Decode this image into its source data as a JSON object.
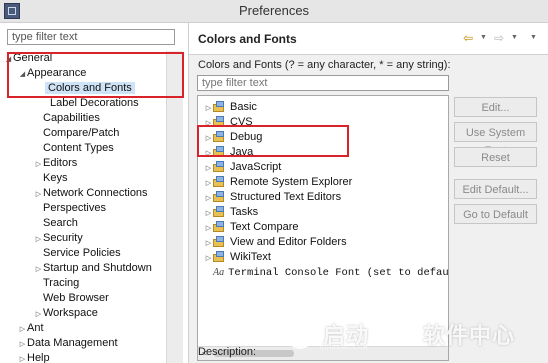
{
  "window": {
    "title": "Preferences"
  },
  "left": {
    "filter_placeholder": "type filter text",
    "tree": [
      {
        "label": "General",
        "arrow": "◢",
        "expanded": true
      },
      {
        "label": "Appearance",
        "arrow": "◢",
        "expanded": true
      },
      {
        "label": "Colors and Fonts",
        "arrow": "",
        "selected": true
      },
      {
        "label": "Label Decorations",
        "arrow": ""
      },
      {
        "label": "Capabilities",
        "arrow": ""
      },
      {
        "label": "Compare/Patch",
        "arrow": ""
      },
      {
        "label": "Content Types",
        "arrow": ""
      },
      {
        "label": "Editors",
        "arrow": "▷"
      },
      {
        "label": "Keys",
        "arrow": ""
      },
      {
        "label": "Network Connections",
        "arrow": "▷"
      },
      {
        "label": "Perspectives",
        "arrow": ""
      },
      {
        "label": "Search",
        "arrow": ""
      },
      {
        "label": "Security",
        "arrow": "▷"
      },
      {
        "label": "Service Policies",
        "arrow": ""
      },
      {
        "label": "Startup and Shutdown",
        "arrow": "▷"
      },
      {
        "label": "Tracing",
        "arrow": ""
      },
      {
        "label": "Web Browser",
        "arrow": ""
      },
      {
        "label": "Workspace",
        "arrow": "▷"
      },
      {
        "label": "Ant",
        "arrow": "▷"
      },
      {
        "label": "Data Management",
        "arrow": "▷"
      },
      {
        "label": "Help",
        "arrow": "▷"
      }
    ]
  },
  "right": {
    "page_title": "Colors and Fonts",
    "subtitle": "Colors and Fonts (? = any character, * = any string):",
    "filter_placeholder": "type filter text",
    "categories": [
      {
        "label": "Basic"
      },
      {
        "label": "CVS"
      },
      {
        "label": "Debug"
      },
      {
        "label": "Java"
      },
      {
        "label": "JavaScript"
      },
      {
        "label": "Remote System Explorer"
      },
      {
        "label": "Structured Text Editors"
      },
      {
        "label": "Tasks"
      },
      {
        "label": "Text Compare"
      },
      {
        "label": "View and Editor Folders"
      },
      {
        "label": "WikiText"
      }
    ],
    "font_item": {
      "prefix": "Aa",
      "label": "Terminal Console Font (set to default"
    },
    "buttons": {
      "edit": "Edit...",
      "use_system_font": "Use System Font",
      "reset": "Reset",
      "edit_default": "Edit Default...",
      "goto_default": "Go to Default"
    },
    "description_label": "Description:"
  },
  "watermark": {
    "brand_cn": "启动",
    "slogan_cn": "软件中心",
    "url": "UQIDONG.COM"
  },
  "colors": {
    "highlight_red": "#d8232a",
    "selection_blue": "#cfe3f7",
    "nav_arrow": "#c88a00"
  }
}
